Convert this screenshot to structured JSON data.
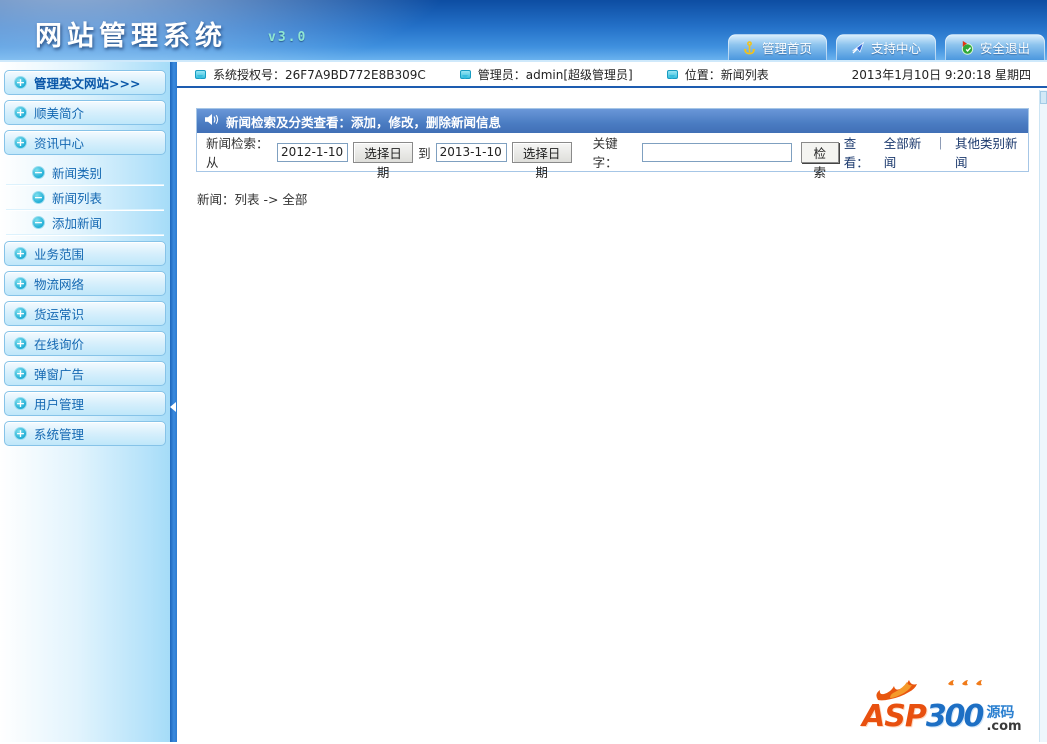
{
  "header": {
    "title": "网站管理系统",
    "version": "v3.0",
    "tabs": [
      {
        "label": "管理首页"
      },
      {
        "label": "支持中心"
      },
      {
        "label": "安全退出"
      }
    ]
  },
  "infobar": {
    "auth": "系统授权号：26F7A9BD772E8B309C",
    "admin": "管理员：admin[超级管理员]",
    "location": "位置：新闻列表",
    "datetime": "2013年1月10日  9:20:18 星期四"
  },
  "sidebar": {
    "items": [
      {
        "label": "管理英文网站>>>"
      },
      {
        "label": "顺美简介"
      },
      {
        "label": "资讯中心"
      },
      {
        "label": "业务范围"
      },
      {
        "label": "物流网络"
      },
      {
        "label": "货运常识"
      },
      {
        "label": "在线询价"
      },
      {
        "label": "弹窗广告"
      },
      {
        "label": "用户管理"
      },
      {
        "label": "系统管理"
      }
    ],
    "submenu": [
      {
        "label": "新闻类别"
      },
      {
        "label": "新闻列表"
      },
      {
        "label": "添加新闻"
      }
    ]
  },
  "panel": {
    "title": "新闻检索及分类查看：添加，修改，删除新闻信息",
    "search_label": "新闻检索：从",
    "from_value": "2012-1-10",
    "date_button": "选择日期",
    "to_label": "到",
    "to_value": "2013-1-10",
    "keyword_label": "关键字：",
    "keyword_value": "",
    "search_button": "检索",
    "view_label": "查看：",
    "view_all": "全部新闻",
    "view_divider": "｜",
    "view_other": "其他类别新闻"
  },
  "breadcrumb": "新闻：列表 -> 全部",
  "logo": {
    "asp": "ASP",
    "num": "300",
    "com": ".com",
    "cn": "源码"
  },
  "icons": {
    "plus": "+",
    "minus": "−"
  },
  "colors": {
    "header_blue": "#1e63b8",
    "strip_blue": "#2e7fd6",
    "panel_bar": "#4a7cc2",
    "bubble_cyan": "#38bede"
  }
}
